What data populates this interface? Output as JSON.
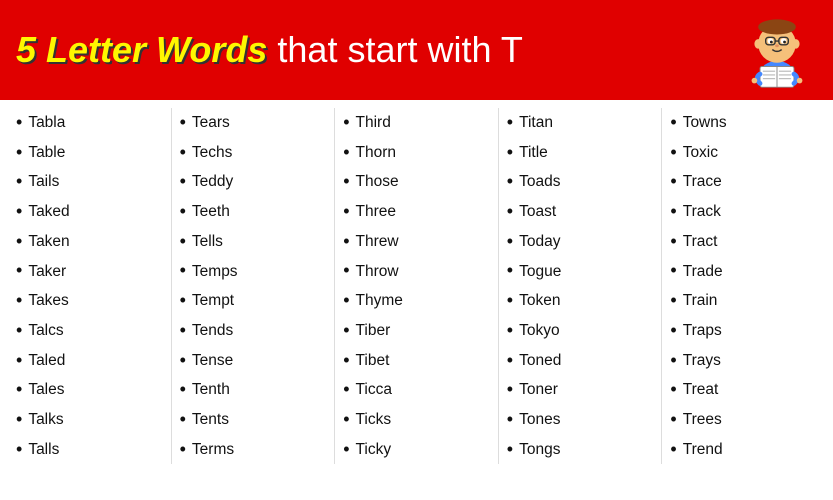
{
  "header": {
    "bold_text": "5 Letter Words",
    "normal_text": " that start with T"
  },
  "columns": [
    {
      "words": [
        "Tabla",
        "Table",
        "Tails",
        "Taked",
        "Taken",
        "Taker",
        "Takes",
        "Talcs",
        "Taled",
        "Tales",
        "Talks",
        "Talls"
      ]
    },
    {
      "words": [
        "Tears",
        "Techs",
        "Teddy",
        "Teeth",
        "Tells",
        "Temps",
        "Tempt",
        "Tends",
        "Tense",
        "Tenth",
        "Tents",
        "Terms"
      ]
    },
    {
      "words": [
        "Third",
        "Thorn",
        "Those",
        "Three",
        "Threw",
        "Throw",
        "Thyme",
        "Tiber",
        "Tibet",
        "Ticca",
        "Ticks",
        "Ticky"
      ]
    },
    {
      "words": [
        "Titan",
        "Title",
        "Toads",
        "Toast",
        "Today",
        "Togue",
        "Token",
        "Tokyo",
        "Toned",
        "Toner",
        "Tones",
        "Tongs"
      ]
    },
    {
      "words": [
        "Towns",
        "Toxic",
        "Trace",
        "Track",
        "Tract",
        "Trade",
        "Train",
        "Traps",
        "Trays",
        "Treat",
        "Trees",
        "Trend"
      ]
    }
  ]
}
